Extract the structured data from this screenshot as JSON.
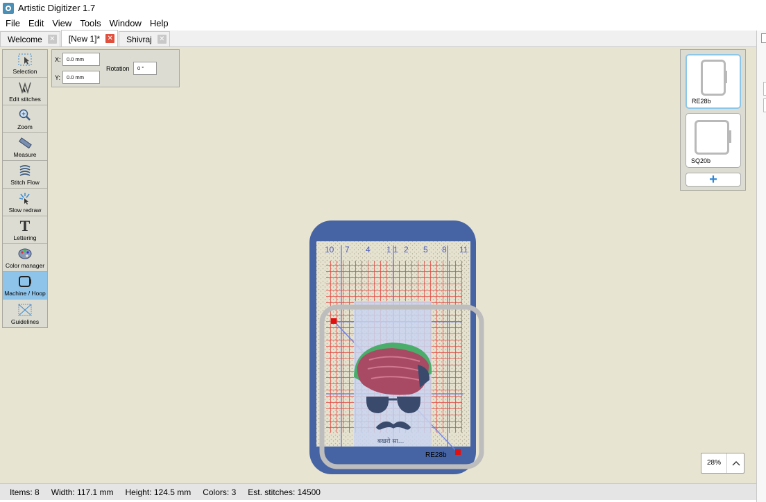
{
  "window": {
    "title": "Artistic Digitizer 1.7"
  },
  "menu": [
    "File",
    "Edit",
    "View",
    "Tools",
    "Window",
    "Help"
  ],
  "tabs": [
    {
      "label": "Welcome",
      "active": false
    },
    {
      "label": "[New 1]*",
      "active": true
    },
    {
      "label": "Shivraj",
      "active": false
    }
  ],
  "tools": [
    {
      "label": "Selection",
      "icon": "selection-icon",
      "selected": false
    },
    {
      "label": "Edit stitches",
      "icon": "edit-stitches-icon",
      "selected": false
    },
    {
      "label": "Zoom",
      "icon": "zoom-icon",
      "selected": false
    },
    {
      "label": "Measure",
      "icon": "measure-icon",
      "selected": false
    },
    {
      "label": "Stitch Flow",
      "icon": "stitch-flow-icon",
      "selected": false
    },
    {
      "label": "Slow redraw",
      "icon": "slow-redraw-icon",
      "selected": false
    },
    {
      "label": "Lettering",
      "icon": "lettering-icon",
      "selected": false
    },
    {
      "label": "Color manager",
      "icon": "color-manager-icon",
      "selected": false
    },
    {
      "label": "Machine / Hoop",
      "icon": "hoop-icon",
      "selected": true
    },
    {
      "label": "Guidelines",
      "icon": "guidelines-icon",
      "selected": false
    }
  ],
  "position": {
    "x_label": "X:",
    "x_value": "0.0 mm",
    "y_label": "Y:",
    "y_value": "0.0 mm",
    "rotation_label": "Rotation",
    "rotation_value": "0 °"
  },
  "hoops": [
    {
      "name": "RE28b",
      "selected": true
    },
    {
      "name": "SQ20b",
      "selected": false
    }
  ],
  "hoop_add_label": "+",
  "canvas": {
    "hoop_label": "RE28b",
    "ruler_top": [
      "10",
      "7",
      "4",
      "1",
      "1",
      "2",
      "5",
      "8",
      "11"
    ],
    "design_caption": "बखरो सा..."
  },
  "zoom": {
    "value": "28%"
  },
  "status": {
    "items": "Items: 8",
    "width": "Width: 117.1 mm",
    "height": "Height: 124.5 mm",
    "colors": "Colors: 3",
    "stitches": "Est. stitches: 14500"
  },
  "colors": {
    "canvas_bg": "#e8e4d2",
    "hoop_blue": "#4664a4",
    "selected_tool": "#8fc4ea",
    "turban_green": "#4aad6a",
    "turban_red": "#a84a64",
    "face_dark": "#3a4a6c",
    "grid_red": "#e03a34",
    "grid_blue": "#6b7de0"
  }
}
